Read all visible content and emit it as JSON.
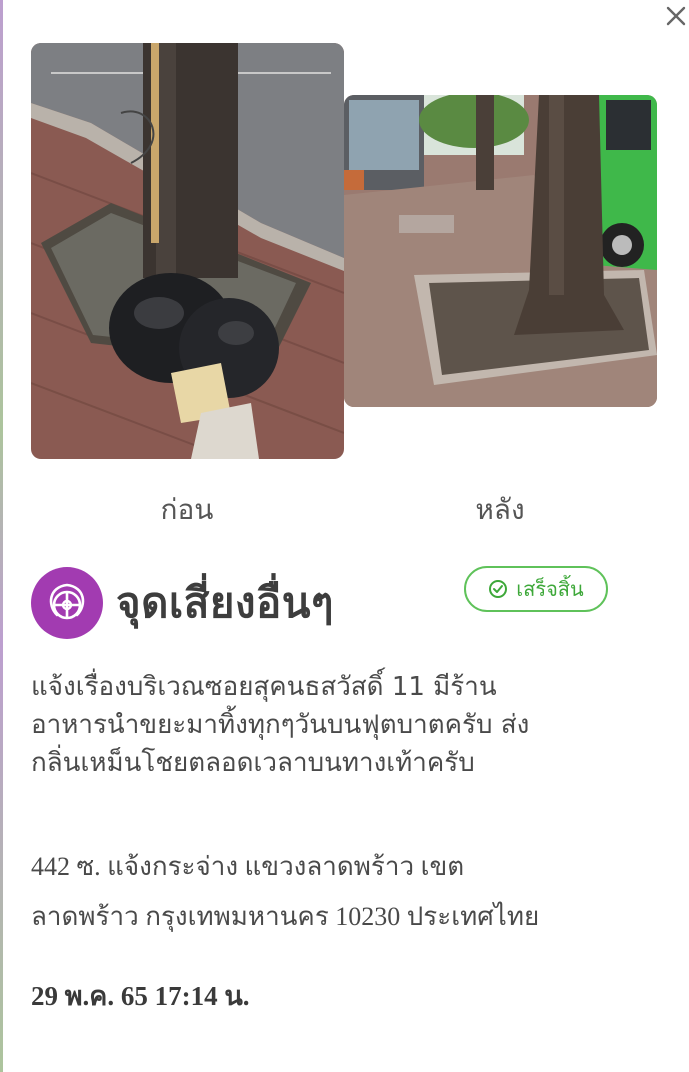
{
  "photos": {
    "before_label": "ก่อน",
    "after_label": "หลัง"
  },
  "category": {
    "title": "จุดเสี่ยงอื่นๆ",
    "icon": "pin-icon",
    "icon_color": "#a23bb1"
  },
  "status": {
    "label": "เสร็จสิ้น",
    "icon": "check-circle-icon",
    "color": "#5fc25a"
  },
  "report": {
    "description_lines": [
      "แจ้งเรื่องบริเวณซอยสุคนธสวัสดิ์ 11 มีร้าน",
      "อาหารนำขยะมาทิ้งทุกๆวันบนฟุตบาตครับ ส่ง",
      "กลิ่นเหม็นโชยตลอดเวลาบนทางเท้าครับ"
    ],
    "address_lines": [
      "442 ซ. แจ้งกระจ่าง แขวงลาดพร้าว เขต",
      "ลาดพร้าว กรุงเทพมหานคร 10230 ประเทศไทย"
    ],
    "timestamp": "29 พ.ค. 65 17:14 น."
  },
  "close": {
    "icon": "close-icon"
  }
}
